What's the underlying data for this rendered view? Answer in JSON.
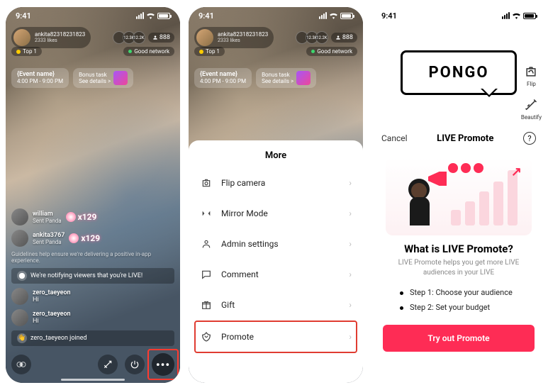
{
  "status": {
    "time": "9:41"
  },
  "host": {
    "username": "ankita82318231823",
    "likes": "2333 likes"
  },
  "viewers": {
    "badge1": "12.3K",
    "badge2": "12.2K",
    "count": "888"
  },
  "topBadge": "Top 1",
  "networkBadge": "Good network",
  "event": {
    "name": "{Event name}",
    "time": "4:00 PM - 9:00 PM"
  },
  "bonus": {
    "title": "Bonus task",
    "sub": "See details >"
  },
  "chat": {
    "gift1": {
      "name": "william",
      "sub": "Sent Panda",
      "count": "x129"
    },
    "gift2": {
      "name": "ankita3767",
      "sub": "Sent Panda",
      "count": "x129"
    },
    "guideline": "Guidelines help ensure we're delivering a positive in-app experience.",
    "notify": "We're notifying viewers that you're LIVE!",
    "msg1": {
      "name": "zero_taeyeon",
      "text": "Hi"
    },
    "msg2": {
      "name": "zero_taeyeon",
      "text": "Hi"
    },
    "join": "zero_taeyeon joined"
  },
  "moreSheet": {
    "title": "More",
    "items": {
      "flip": "Flip camera",
      "mirror": "Mirror Mode",
      "admin": "Admin settings",
      "comment": "Comment",
      "gift": "Gift",
      "promote": "Promote"
    }
  },
  "promoteSheet": {
    "cancel": "Cancel",
    "title": "LIVE Promote",
    "heading": "What is LIVE Promote?",
    "sub": "LIVE Promote helps you get more LIVE audiences in your LIVE",
    "step1": "Step 1: Choose your audience",
    "step2": "Step 2: Set your budget",
    "cta": "Try out Promote"
  },
  "sideTools": {
    "flip": "Flip",
    "beautify": "Beautify"
  },
  "pongo": "PONGO"
}
